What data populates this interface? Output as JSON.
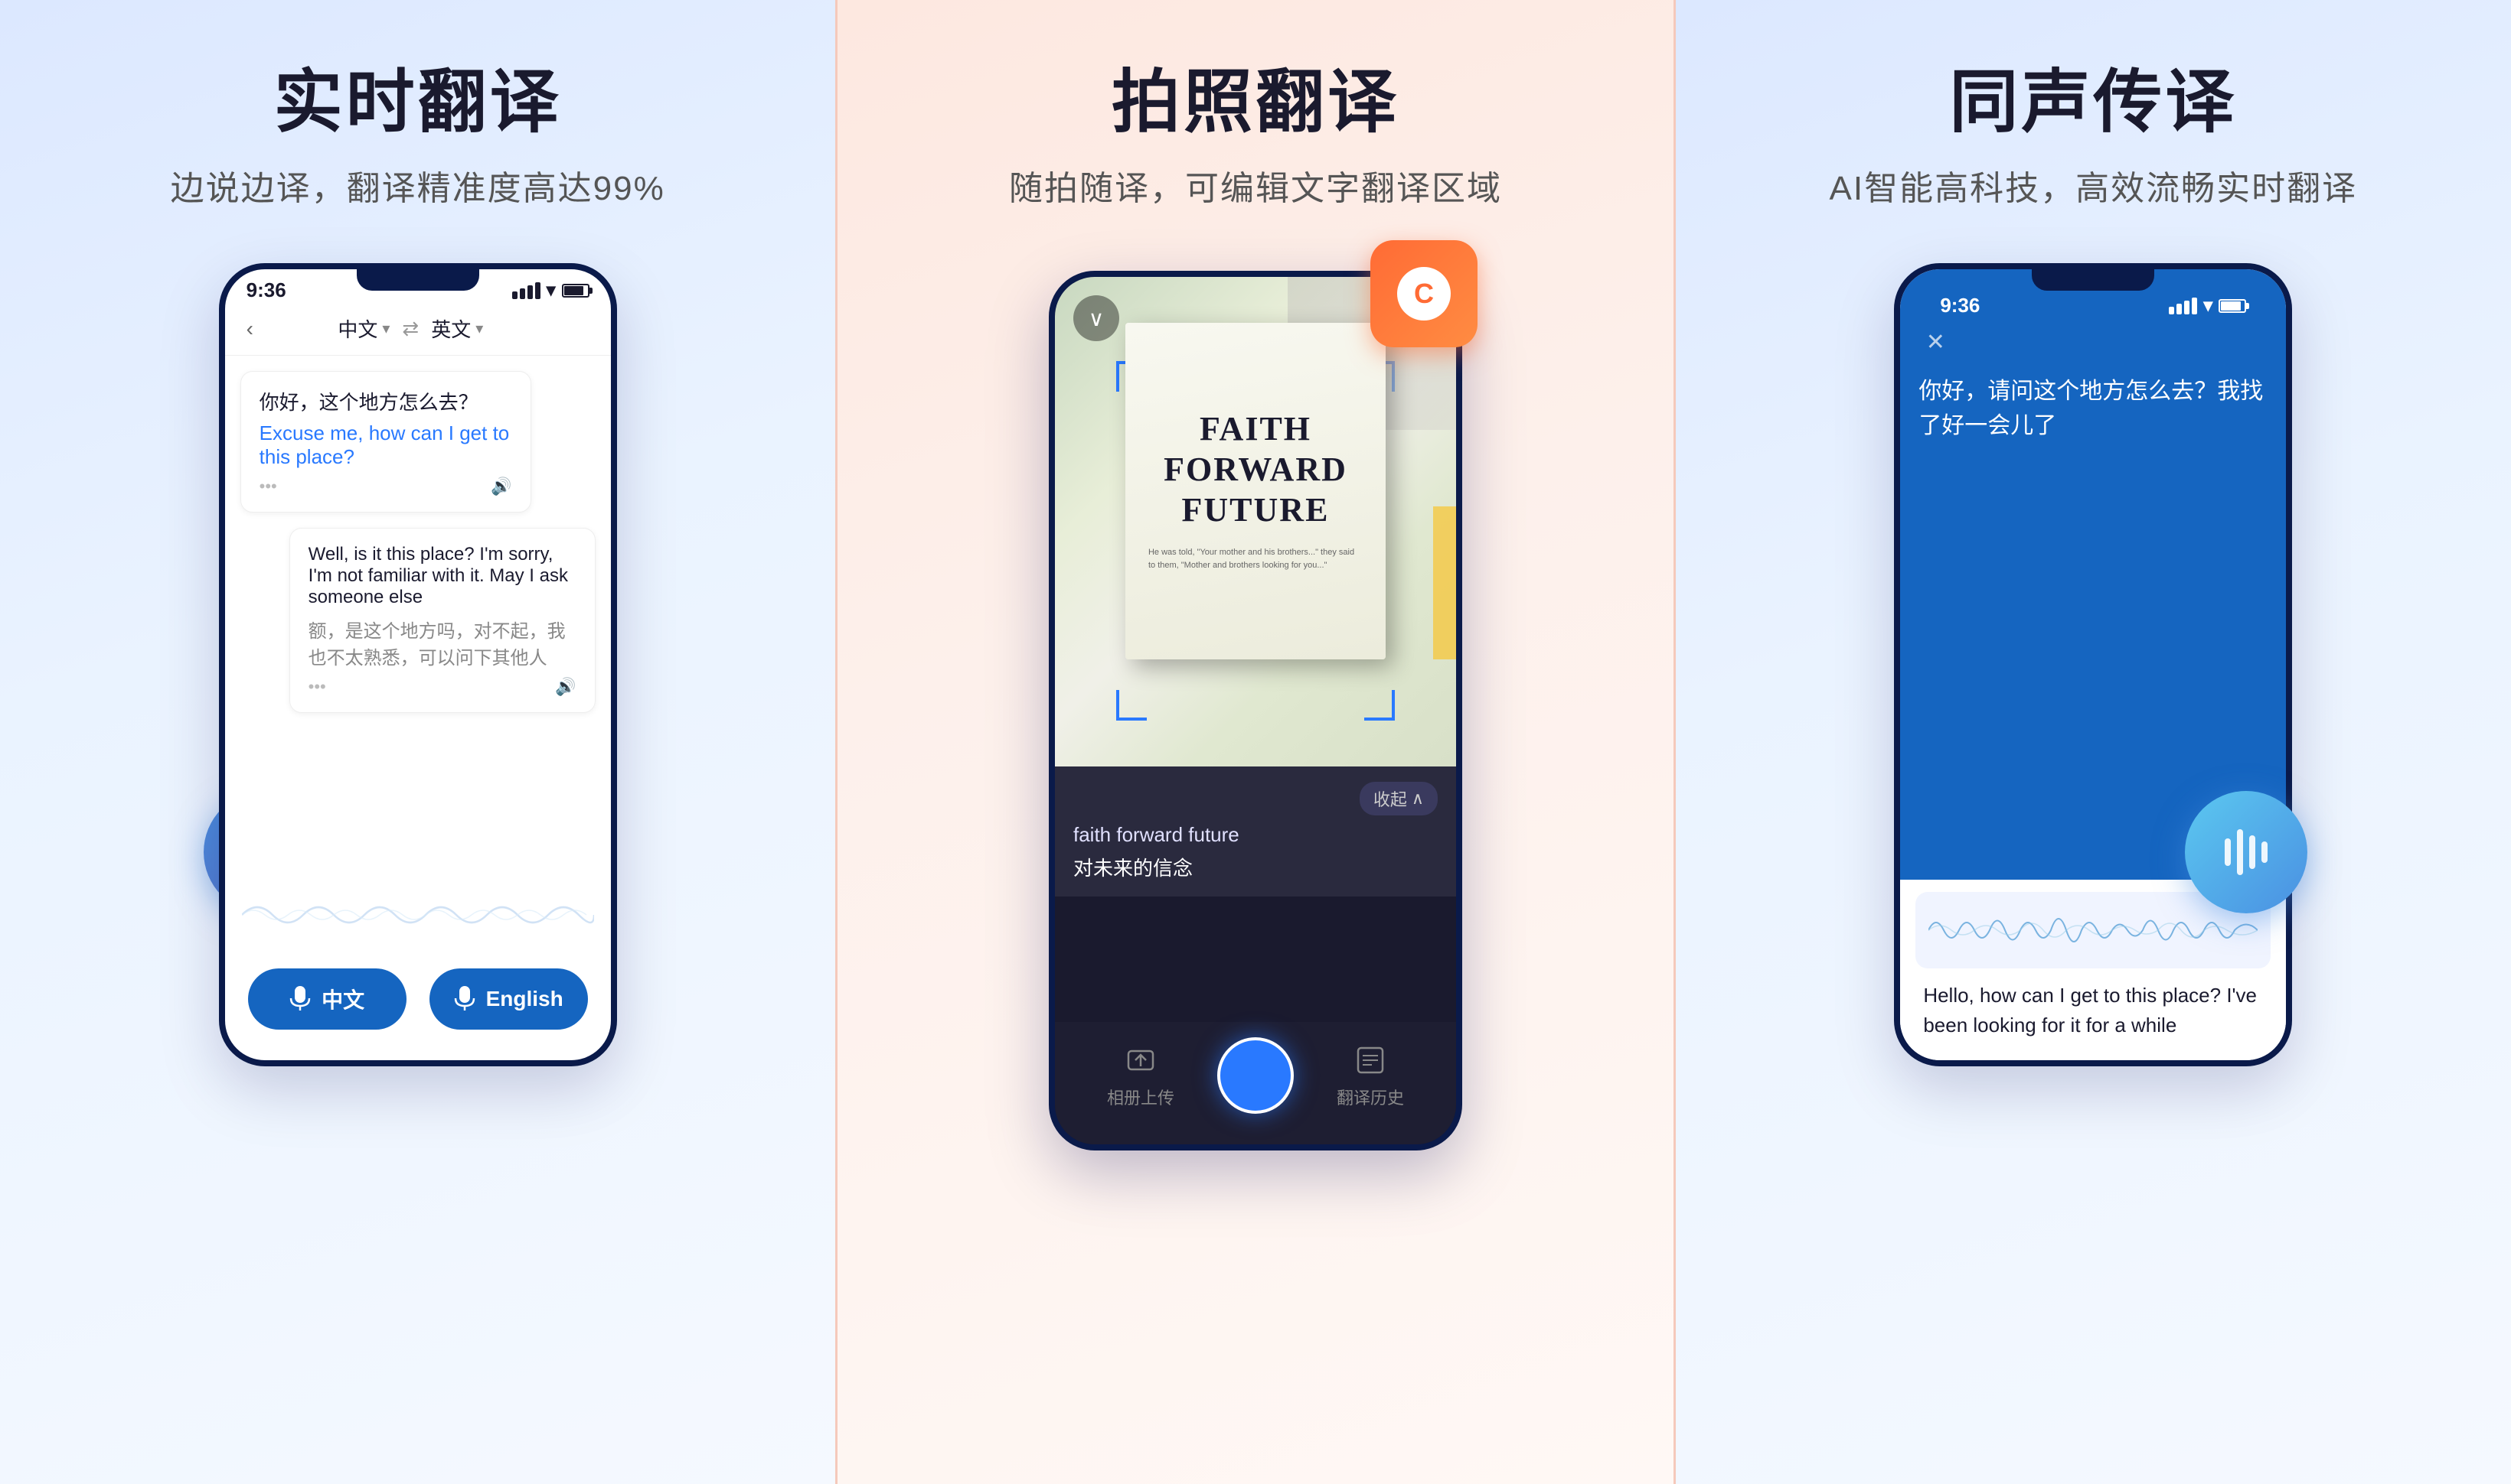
{
  "panels": [
    {
      "id": "realtime",
      "title": "实时翻译",
      "subtitle": "边说边译，翻译精准度高达99%",
      "phone": {
        "time": "9:36",
        "from_lang": "中文",
        "to_lang": "英文",
        "chat": [
          {
            "chinese": "你好，这个地方怎么去？",
            "english": "Excuse me, how can I get to this place?"
          },
          {
            "english": "Well, is it this place? I'm sorry, I'm not familiar with it. May I ask someone else",
            "chinese": "额，是这个地方吗，对不起，我也不太熟悉，可以问下其他人"
          }
        ]
      },
      "btn_chinese": "中文",
      "btn_english": "English"
    },
    {
      "id": "photo",
      "title": "拍照翻译",
      "subtitle": "随拍随译，可编辑文字翻译区域",
      "ocr_original": "faith forward future",
      "ocr_translation": "对未来的信念",
      "book_title": "FAITH\nFORWARD\nFUTURE",
      "collapse_label": "收起",
      "nav_upload": "相册上传",
      "nav_history": "翻译历史"
    },
    {
      "id": "simultaneous",
      "title": "同声传译",
      "subtitle": "AI智能高科技，高效流畅实时翻译",
      "phone": {
        "time": "9:36",
        "chinese_speech": "你好，请问这个地方怎么去？我找了好一会儿了",
        "english_translation": "Hello, how can I get to this place? I've been looking for it for a while"
      }
    }
  ]
}
